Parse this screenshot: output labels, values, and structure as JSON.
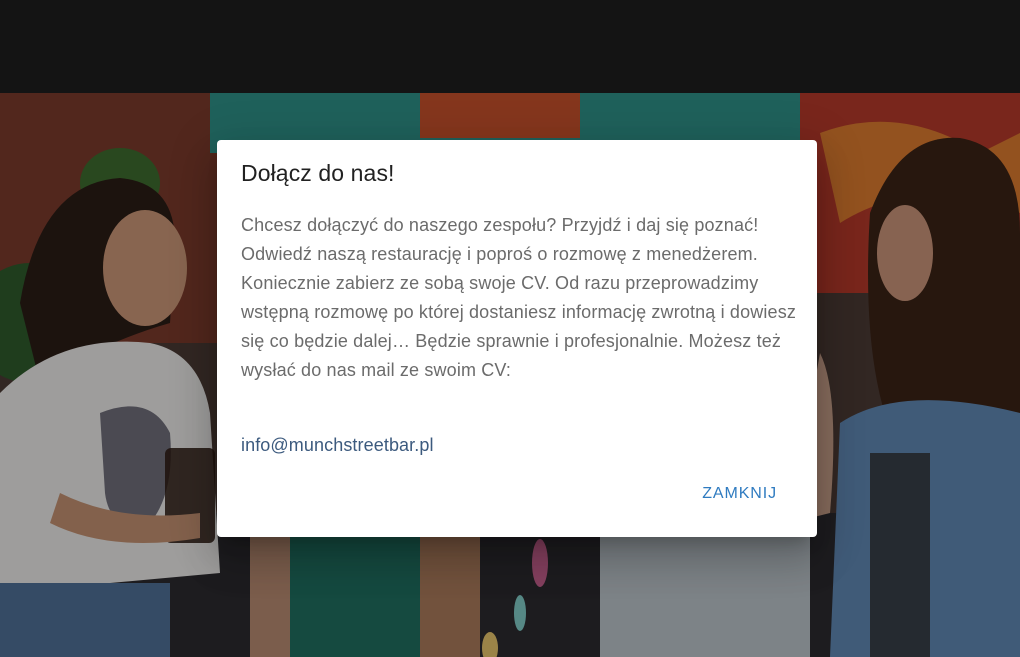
{
  "dialog": {
    "title": "Dołącz do nas!",
    "body": "Chcesz dołączyć do naszego zespołu? Przyjdź i daj się poznać! Odwiedź naszą restaurację i poproś o rozmowę z menedżerem. Koniecznie zabierz ze sobą swoje CV. Od razu przeprowadzimy wstępną rozmowę po której dostaniesz informację zwrotną i dowiesz się co będzie dalej… Będzie sprawnie i profesjonalnie. Możesz też wysłać do nas mail ze swoim CV:",
    "email": "info@munchstreetbar.pl",
    "close_label": "ZAMKNIJ"
  },
  "colors": {
    "header_bar": "#141414",
    "dialog_bg": "#ffffff",
    "title_text": "#212121",
    "body_text": "#6b6b6b",
    "link": "#3c5a7e",
    "button_accent": "#2f7bc0"
  },
  "background": {
    "photo": "people-laughing-in-front-of-mural-photo"
  }
}
